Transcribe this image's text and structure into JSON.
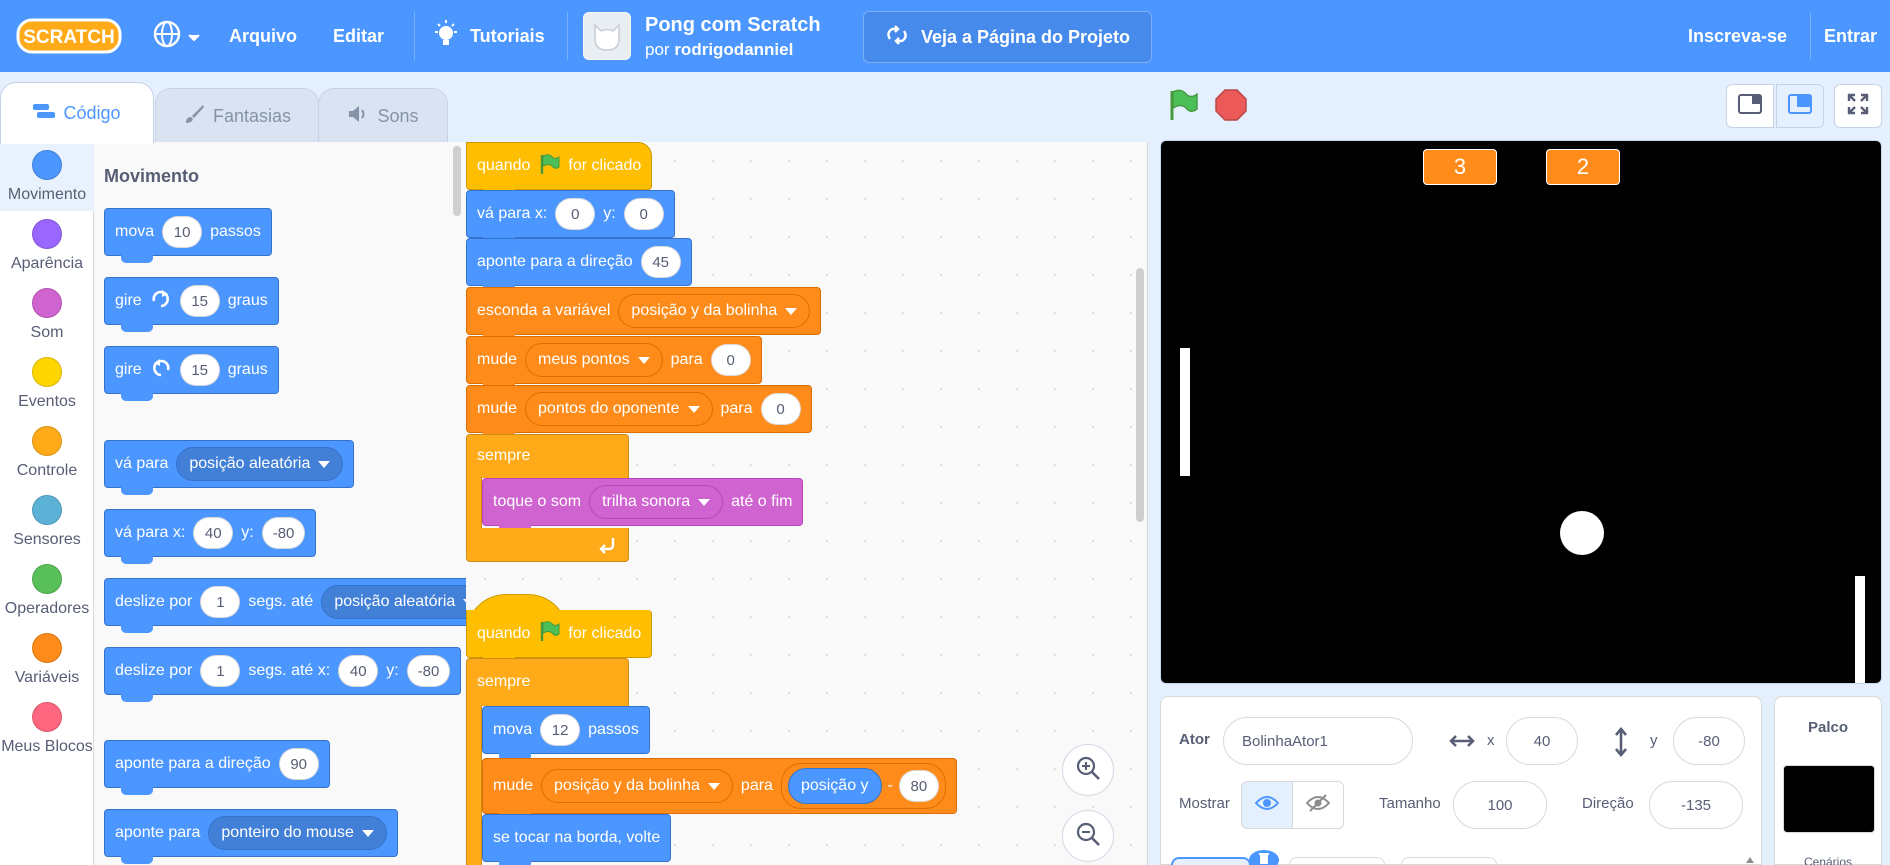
{
  "menubar": {
    "logo": "Scratch",
    "language_icon": "globe-icon",
    "file": "Arquivo",
    "edit": "Editar",
    "tutorials": "Tutoriais",
    "project_title": "Pong com Scratch",
    "author_prefix": "por",
    "author": "rodrigodanniel",
    "see_project": "Veja a Página do Projeto",
    "join": "Inscreva-se",
    "signin": "Entrar"
  },
  "tabs": {
    "code": "Código",
    "costumes": "Fantasias",
    "sounds": "Sons"
  },
  "categories": [
    {
      "label": "Movimento",
      "color": "#4c97ff"
    },
    {
      "label": "Aparência",
      "color": "#9966ff"
    },
    {
      "label": "Som",
      "color": "#cf63cf"
    },
    {
      "label": "Eventos",
      "color": "#ffd500"
    },
    {
      "label": "Controle",
      "color": "#ffab19"
    },
    {
      "label": "Sensores",
      "color": "#5cb1d6"
    },
    {
      "label": "Operadores",
      "color": "#59c059"
    },
    {
      "label": "Variáveis",
      "color": "#ff8c1a"
    },
    {
      "label": "Meus Blocos",
      "color": "#ff6680"
    }
  ],
  "palette": {
    "heading": "Movimento",
    "b1": {
      "a": "mova",
      "v": "10",
      "b": "passos"
    },
    "b2": {
      "a": "gire",
      "v": "15",
      "b": "graus"
    },
    "b3": {
      "a": "gire",
      "v": "15",
      "b": "graus"
    },
    "b4": {
      "a": "vá para",
      "dd": "posição aleatória"
    },
    "b5": {
      "a": "vá para x:",
      "x": "40",
      "b": "y:",
      "y": "-80"
    },
    "b6": {
      "a": "deslize por",
      "v": "1",
      "b": "segs. até",
      "dd": "posição aleatória"
    },
    "b7": {
      "a": "deslize por",
      "v": "1",
      "b": "segs. até x:",
      "x": "40",
      "c": "y:",
      "y": "-80"
    },
    "b8": {
      "a": "aponte para a direção",
      "v": "90"
    },
    "b9": {
      "a": "aponte para",
      "dd": "ponteiro do mouse"
    }
  },
  "script1": {
    "hat": {
      "a": "quando",
      "b": "for clicado"
    },
    "goto": {
      "a": "vá para x:",
      "x": "0",
      "b": "y:",
      "y": "0"
    },
    "point": {
      "a": "aponte para a direção",
      "v": "45"
    },
    "hide": {
      "a": "esconda a variável",
      "dd": "posição y da bolinha"
    },
    "set1": {
      "a": "mude",
      "dd": "meus pontos",
      "b": "para",
      "v": "0"
    },
    "set2": {
      "a": "mude",
      "dd": "pontos do oponente",
      "b": "para",
      "v": "0"
    },
    "forever": "sempre",
    "play": {
      "a": "toque o som",
      "dd": "trilha sonora",
      "b": "até o fim"
    }
  },
  "script2": {
    "hat": {
      "a": "quando",
      "b": "for clicado"
    },
    "forever": "sempre",
    "move": {
      "a": "mova",
      "v": "12",
      "b": "passos"
    },
    "set": {
      "a": "mude",
      "dd": "posição y da bolinha",
      "b": "para",
      "rep": "posição y",
      "op": "-",
      "v": "80"
    },
    "bounce": "se tocar na borda, volte"
  },
  "stage": {
    "score_left": "3",
    "score_right": "2"
  },
  "sprite": {
    "label_sprite": "Ator",
    "name": "BolinhaAtor1",
    "x_label": "x",
    "x": "40",
    "y_label": "y",
    "y": "-80",
    "show_label": "Mostrar",
    "size_label": "Tamanho",
    "size": "100",
    "direction_label": "Direção",
    "direction": "-135"
  },
  "stage_panel": {
    "title": "Palco",
    "backdrops_label": "Cenários"
  }
}
